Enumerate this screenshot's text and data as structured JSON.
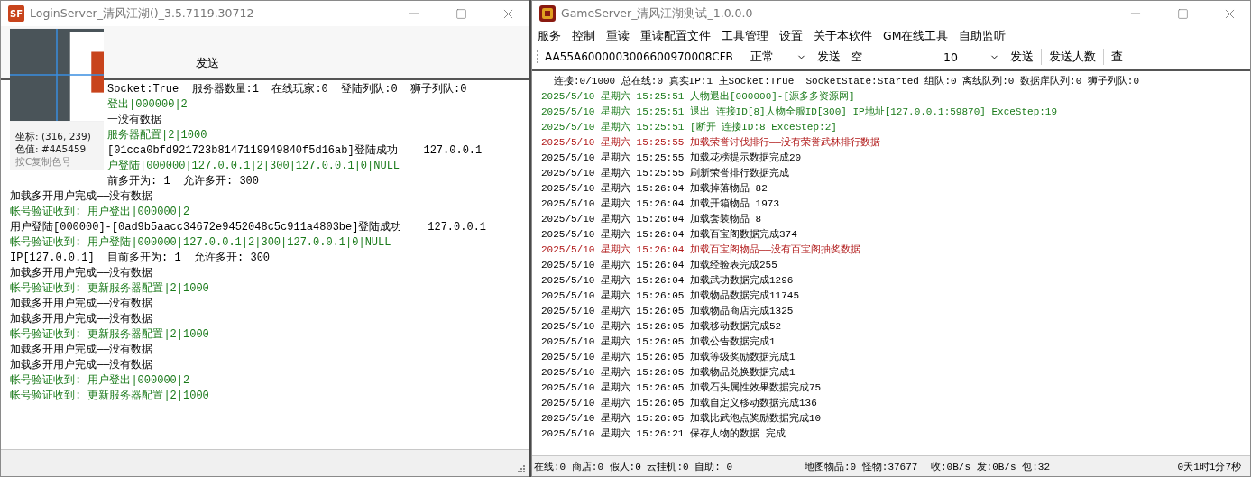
{
  "login_window": {
    "logo_text": "SF",
    "title": "LoginServer_清风江湖()_3.5.7119.30712",
    "toolbar": {
      "send_button": "发送"
    },
    "picker_overlay": {
      "coords": "坐标: (316, 239)",
      "color_value": "色值: #4A5459",
      "hint": "按C复制色号"
    },
    "log_beside_overlay": [
      {
        "text": "Socket:True  服务器数量:1  在线玩家:0  登陆列队:0  狮子列队:0",
        "kind": "info"
      },
      {
        "text": "登出|000000|2",
        "kind": "ok"
      },
      {
        "text": "一没有数据",
        "kind": "info"
      },
      {
        "text": "服务器配置|2|1000",
        "kind": "ok"
      },
      {
        "text": "[01cca0bfd921723b8147119949840f5d16ab]登陆成功    127.0.0.1",
        "kind": "info"
      },
      {
        "text": "户登陆|000000|127.0.0.1|2|300|127.0.0.1|0|NULL",
        "kind": "ok"
      },
      {
        "text": "前多开为: 1  允许多开: 300",
        "kind": "info"
      }
    ],
    "log": [
      {
        "text": "加载多开用户完成——没有数据",
        "kind": "info"
      },
      {
        "text": "帐号验证收到: 用户登出|000000|2",
        "kind": "ok"
      },
      {
        "text": "用户登陆[000000]-[0ad9b5aacc34672e9452048c5c911a4803be]登陆成功    127.0.0.1",
        "kind": "info"
      },
      {
        "text": "帐号验证收到: 用户登陆|000000|127.0.0.1|2|300|127.0.0.1|0|NULL",
        "kind": "ok"
      },
      {
        "text": "IP[127.0.0.1]  目前多开为: 1  允许多开: 300",
        "kind": "info"
      },
      {
        "text": "加载多开用户完成——没有数据",
        "kind": "info"
      },
      {
        "text": "帐号验证收到: 更新服务器配置|2|1000",
        "kind": "ok"
      },
      {
        "text": "加载多开用户完成——没有数据",
        "kind": "info"
      },
      {
        "text": "加载多开用户完成——没有数据",
        "kind": "info"
      },
      {
        "text": "帐号验证收到: 更新服务器配置|2|1000",
        "kind": "ok"
      },
      {
        "text": "加载多开用户完成——没有数据",
        "kind": "info"
      },
      {
        "text": "加载多开用户完成——没有数据",
        "kind": "info"
      },
      {
        "text": "帐号验证收到: 用户登出|000000|2",
        "kind": "ok"
      },
      {
        "text": "帐号验证收到: 更新服务器配置|2|1000",
        "kind": "ok"
      }
    ]
  },
  "game_window": {
    "title": "GameServer_清风江湖测试_1.0.0.0",
    "menu": [
      "服务",
      "控制",
      "重读",
      "重读配置文件",
      "工具管理",
      "设置",
      "关于本软件",
      "GM在线工具",
      "自助监听"
    ],
    "toolbar": {
      "code_field": "AA55A6000003006600970008CFB",
      "mode_select": "正常",
      "send_button": "发送",
      "message_field": "空",
      "count_select": "10",
      "send_button_2": "发送",
      "send_count_button": "发送人数",
      "query_button": "查"
    },
    "status_line": "连接:0/1000 总在线:0 真实IP:1 主Socket:True  SocketState:Started 组队:0 离线队列:0 数据库队列:0 狮子列队:0",
    "log": [
      {
        "text": "2025/5/10 星期六 15:25:51 人物退出[000000]-[源多多资源网]",
        "kind": "ok"
      },
      {
        "text": "2025/5/10 星期六 15:25:51 退出 连接ID[8]人物全服ID[300] IP地址[127.0.0.1:59870] ExceStep:19",
        "kind": "ok"
      },
      {
        "text": "2025/5/10 星期六 15:25:51 [断开 连接ID:8 ExceStep:2]",
        "kind": "ok"
      },
      {
        "text": "2025/5/10 星期六 15:25:55 加载荣誉讨伐排行——没有荣誉武林排行数据",
        "kind": "error"
      },
      {
        "text": "2025/5/10 星期六 15:25:55 加载花榜提示数据完成20",
        "kind": "info"
      },
      {
        "text": "2025/5/10 星期六 15:25:55 刷新荣誉排行数据完成",
        "kind": "info"
      },
      {
        "text": "2025/5/10 星期六 15:26:04 加载掉落物品 82",
        "kind": "info"
      },
      {
        "text": "2025/5/10 星期六 15:26:04 加载开箱物品 1973",
        "kind": "info"
      },
      {
        "text": "2025/5/10 星期六 15:26:04 加载套装物品 8",
        "kind": "info"
      },
      {
        "text": "2025/5/10 星期六 15:26:04 加载百宝阁数据完成374",
        "kind": "info"
      },
      {
        "text": "2025/5/10 星期六 15:26:04 加载百宝阁物品——没有百宝阁抽奖数据",
        "kind": "error"
      },
      {
        "text": "2025/5/10 星期六 15:26:04 加载经验表完成255",
        "kind": "info"
      },
      {
        "text": "2025/5/10 星期六 15:26:04 加载武功数据完成1296",
        "kind": "info"
      },
      {
        "text": "2025/5/10 星期六 15:26:05 加载物品数据完成11745",
        "kind": "info"
      },
      {
        "text": "2025/5/10 星期六 15:26:05 加载物品商店完成1325",
        "kind": "info"
      },
      {
        "text": "2025/5/10 星期六 15:26:05 加载移动数据完成52",
        "kind": "info"
      },
      {
        "text": "2025/5/10 星期六 15:26:05 加载公告数据完成1",
        "kind": "info"
      },
      {
        "text": "2025/5/10 星期六 15:26:05 加载等级奖励数据完成1",
        "kind": "info"
      },
      {
        "text": "2025/5/10 星期六 15:26:05 加载物品兑换数据完成1",
        "kind": "info"
      },
      {
        "text": "2025/5/10 星期六 15:26:05 加载石头属性效果数据完成75",
        "kind": "info"
      },
      {
        "text": "2025/5/10 星期六 15:26:05 加载自定义移动数据完成136",
        "kind": "info"
      },
      {
        "text": "2025/5/10 星期六 15:26:05 加载比武泡点奖励数据完成10",
        "kind": "info"
      },
      {
        "text": "2025/5/10 星期六 15:26:21 保存人物的数据 完成",
        "kind": "info"
      }
    ],
    "status_bar": [
      "在线:0 商店:0 假人:0 云挂机:0 自助: 0",
      "地图物品:0 怪物:37677",
      "收:0B/s 发:0B/s 包:32",
      "0天1时1分7秒"
    ]
  }
}
